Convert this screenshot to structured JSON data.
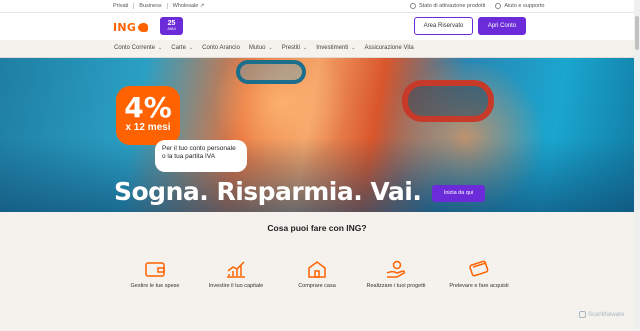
{
  "utilbar": {
    "segments": [
      "Privati",
      "Business",
      "Wholesale"
    ],
    "status_link": "Stato di attivazione prodotti",
    "help_link": "Aiuto e supporto"
  },
  "header": {
    "logo_text": "ING",
    "anniversary_number": "25",
    "anniversary_word": "ANNI",
    "area_riservata": "Area Riservato",
    "apri_conto": "Apri Conto"
  },
  "nav": {
    "items": [
      {
        "label": "Conto Corrente",
        "dropdown": true
      },
      {
        "label": "Carte",
        "dropdown": true
      },
      {
        "label": "Conto Arancio",
        "dropdown": false
      },
      {
        "label": "Mutuo",
        "dropdown": true
      },
      {
        "label": "Prestiti",
        "dropdown": true
      },
      {
        "label": "Investimenti",
        "dropdown": true
      },
      {
        "label": "Assicurazione Vita",
        "dropdown": false
      }
    ]
  },
  "hero": {
    "promo_rate": "4%",
    "promo_duration": "x 12 mesi",
    "bubble_text": "Per il tuo conto personale o la tua partita IVA",
    "slogan": "Sogna. Risparmia. Vai.",
    "cta": "Inizia da qui"
  },
  "features": {
    "title": "Cosa puoi fare con ING?",
    "items": [
      {
        "label": "Gestire le tue spese",
        "icon": "wallet-icon"
      },
      {
        "label": "Investire il tuo capitale",
        "icon": "chart-up-icon"
      },
      {
        "label": "Comprare casa",
        "icon": "house-icon"
      },
      {
        "label": "Realizzare i tuoi progetti",
        "icon": "hand-coin-icon"
      },
      {
        "label": "Prelevare e fare acquisti",
        "icon": "card-icon"
      }
    ]
  },
  "colors": {
    "brand_orange": "#ff6200",
    "brand_purple": "#6c2bd9",
    "background": "#f5f1ed"
  },
  "watermark": "ScanMalware"
}
